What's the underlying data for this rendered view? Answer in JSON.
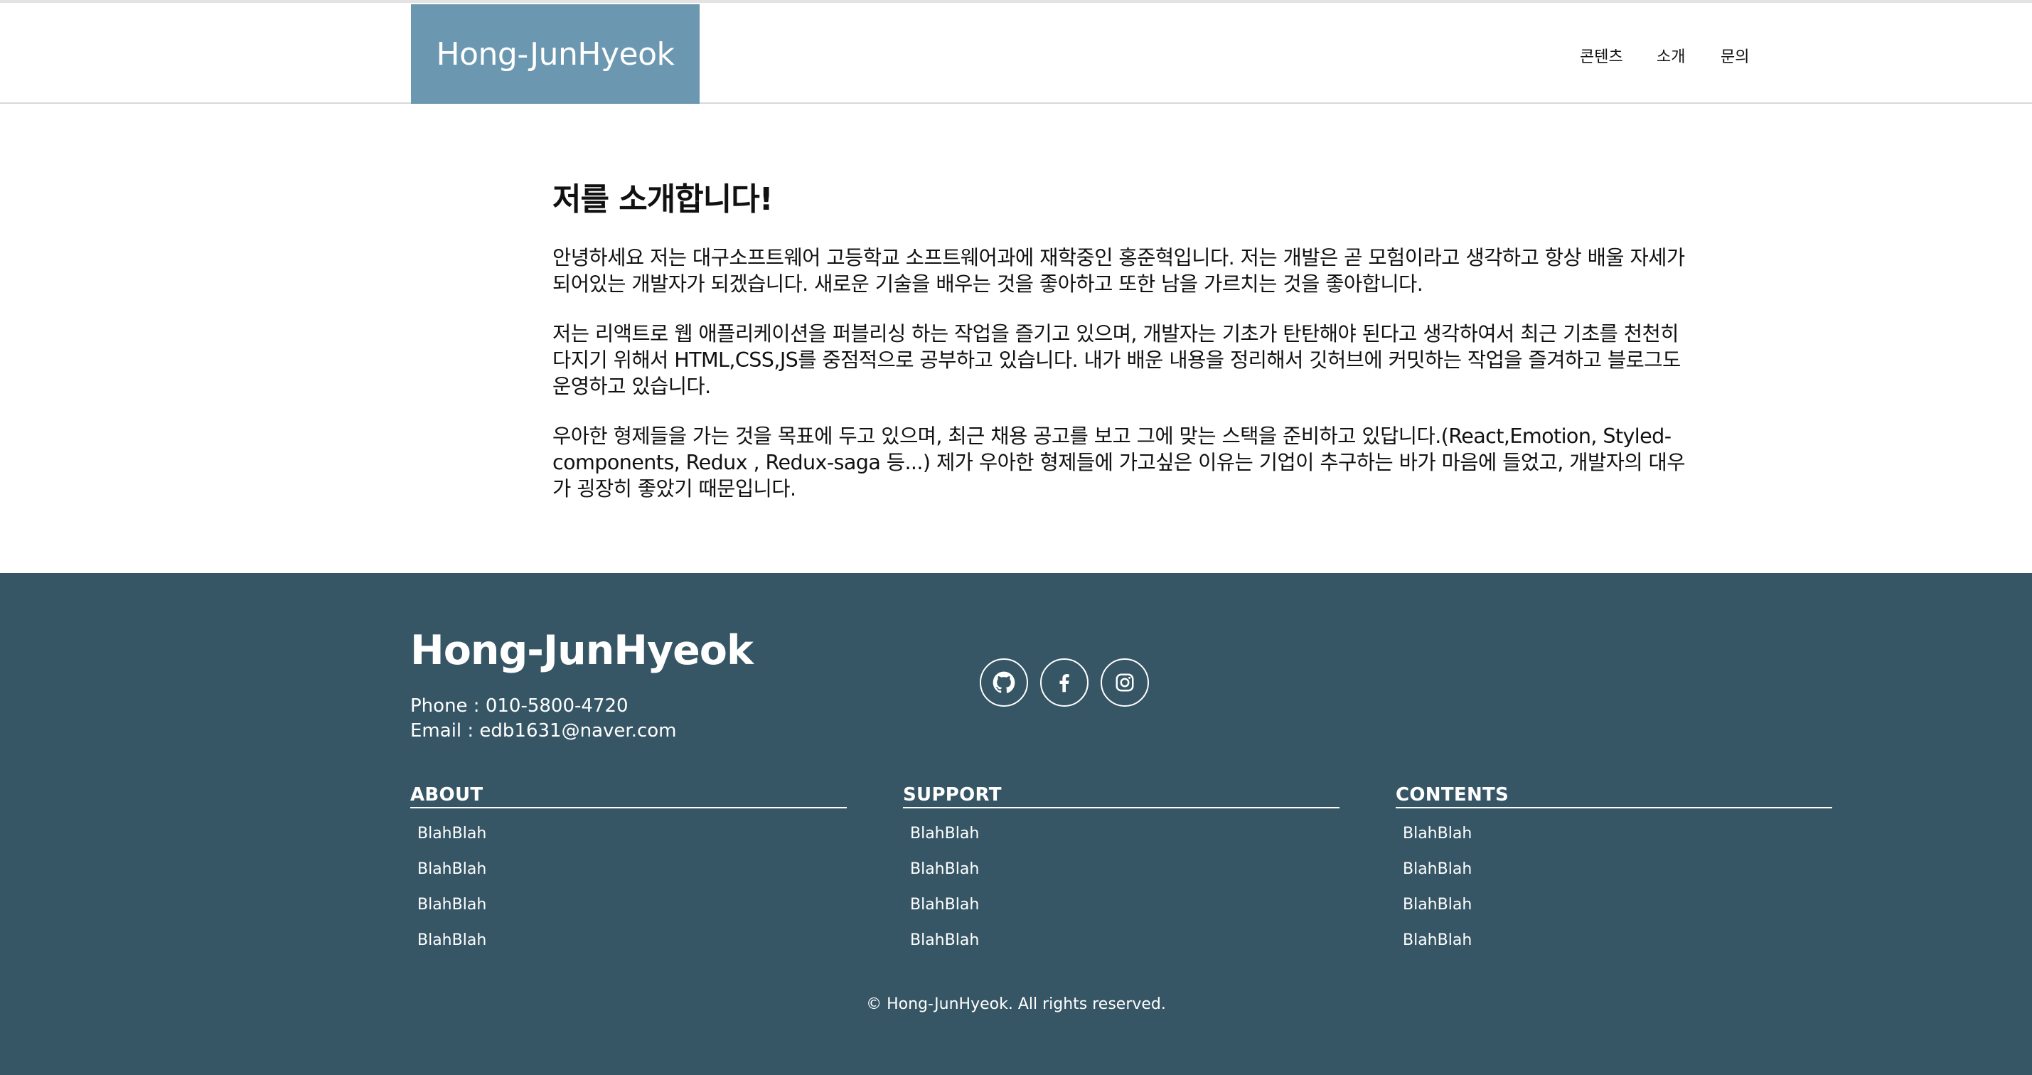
{
  "header": {
    "logo": "Hong-JunHyeok",
    "nav": [
      "콘텐츠",
      "소개",
      "문의"
    ]
  },
  "intro": {
    "title": "저를 소개합니다!",
    "paragraphs": [
      "안녕하세요 저는 대구소프트웨어 고등학교 소프트웨어과에 재학중인 홍준혁입니다. 저는 개발은 곧 모험이라고 생각하고 항상 배울 자세가 되어있는 개발자가 되겠습니다. 새로운 기술을 배우는 것을 좋아하고 또한 남을 가르치는 것을 좋아합니다.",
      "저는 리액트로 웹 애플리케이션을 퍼블리싱 하는 작업을 즐기고 있으며, 개발자는 기초가 탄탄해야 된다고 생각하여서 최근 기초를 천천히 다지기 위해서 HTML,CSS,JS를 중점적으로 공부하고 있습니다. 내가 배운 내용을 정리해서 깃허브에 커밋하는 작업을 즐겨하고 블로그도 운영하고 있습니다.",
      "우아한 형제들을 가는 것을 목표에 두고 있으며, 최근 채용 공고를 보고 그에 맞는 스택을 준비하고 있답니다.(React,Emotion, Styled-components, Redux , Redux-saga 등...) 제가 우아한 형제들에 가고싶은 이유는 기업이 추구하는 바가 마음에 들었고, 개발자의 대우가 굉장히 좋았기 때문입니다."
    ]
  },
  "footer": {
    "title": "Hong-JunHyeok",
    "phone": "Phone : 010-5800-4720",
    "email": "Email : edb1631@naver.com",
    "social_icons": [
      "github-icon",
      "facebook-icon",
      "instagram-icon"
    ],
    "columns": [
      {
        "title": "ABOUT",
        "items": [
          "BlahBlah",
          "BlahBlah",
          "BlahBlah",
          "BlahBlah"
        ]
      },
      {
        "title": "SUPPORT",
        "items": [
          "BlahBlah",
          "BlahBlah",
          "BlahBlah",
          "BlahBlah"
        ]
      },
      {
        "title": "CONTENTS",
        "items": [
          "BlahBlah",
          "BlahBlah",
          "BlahBlah",
          "BlahBlah"
        ]
      }
    ],
    "copyright": "© Hong-JunHyeok. All rights reserved."
  },
  "colors": {
    "logo_bg": "#6b98b0",
    "footer_bg": "#365666"
  }
}
